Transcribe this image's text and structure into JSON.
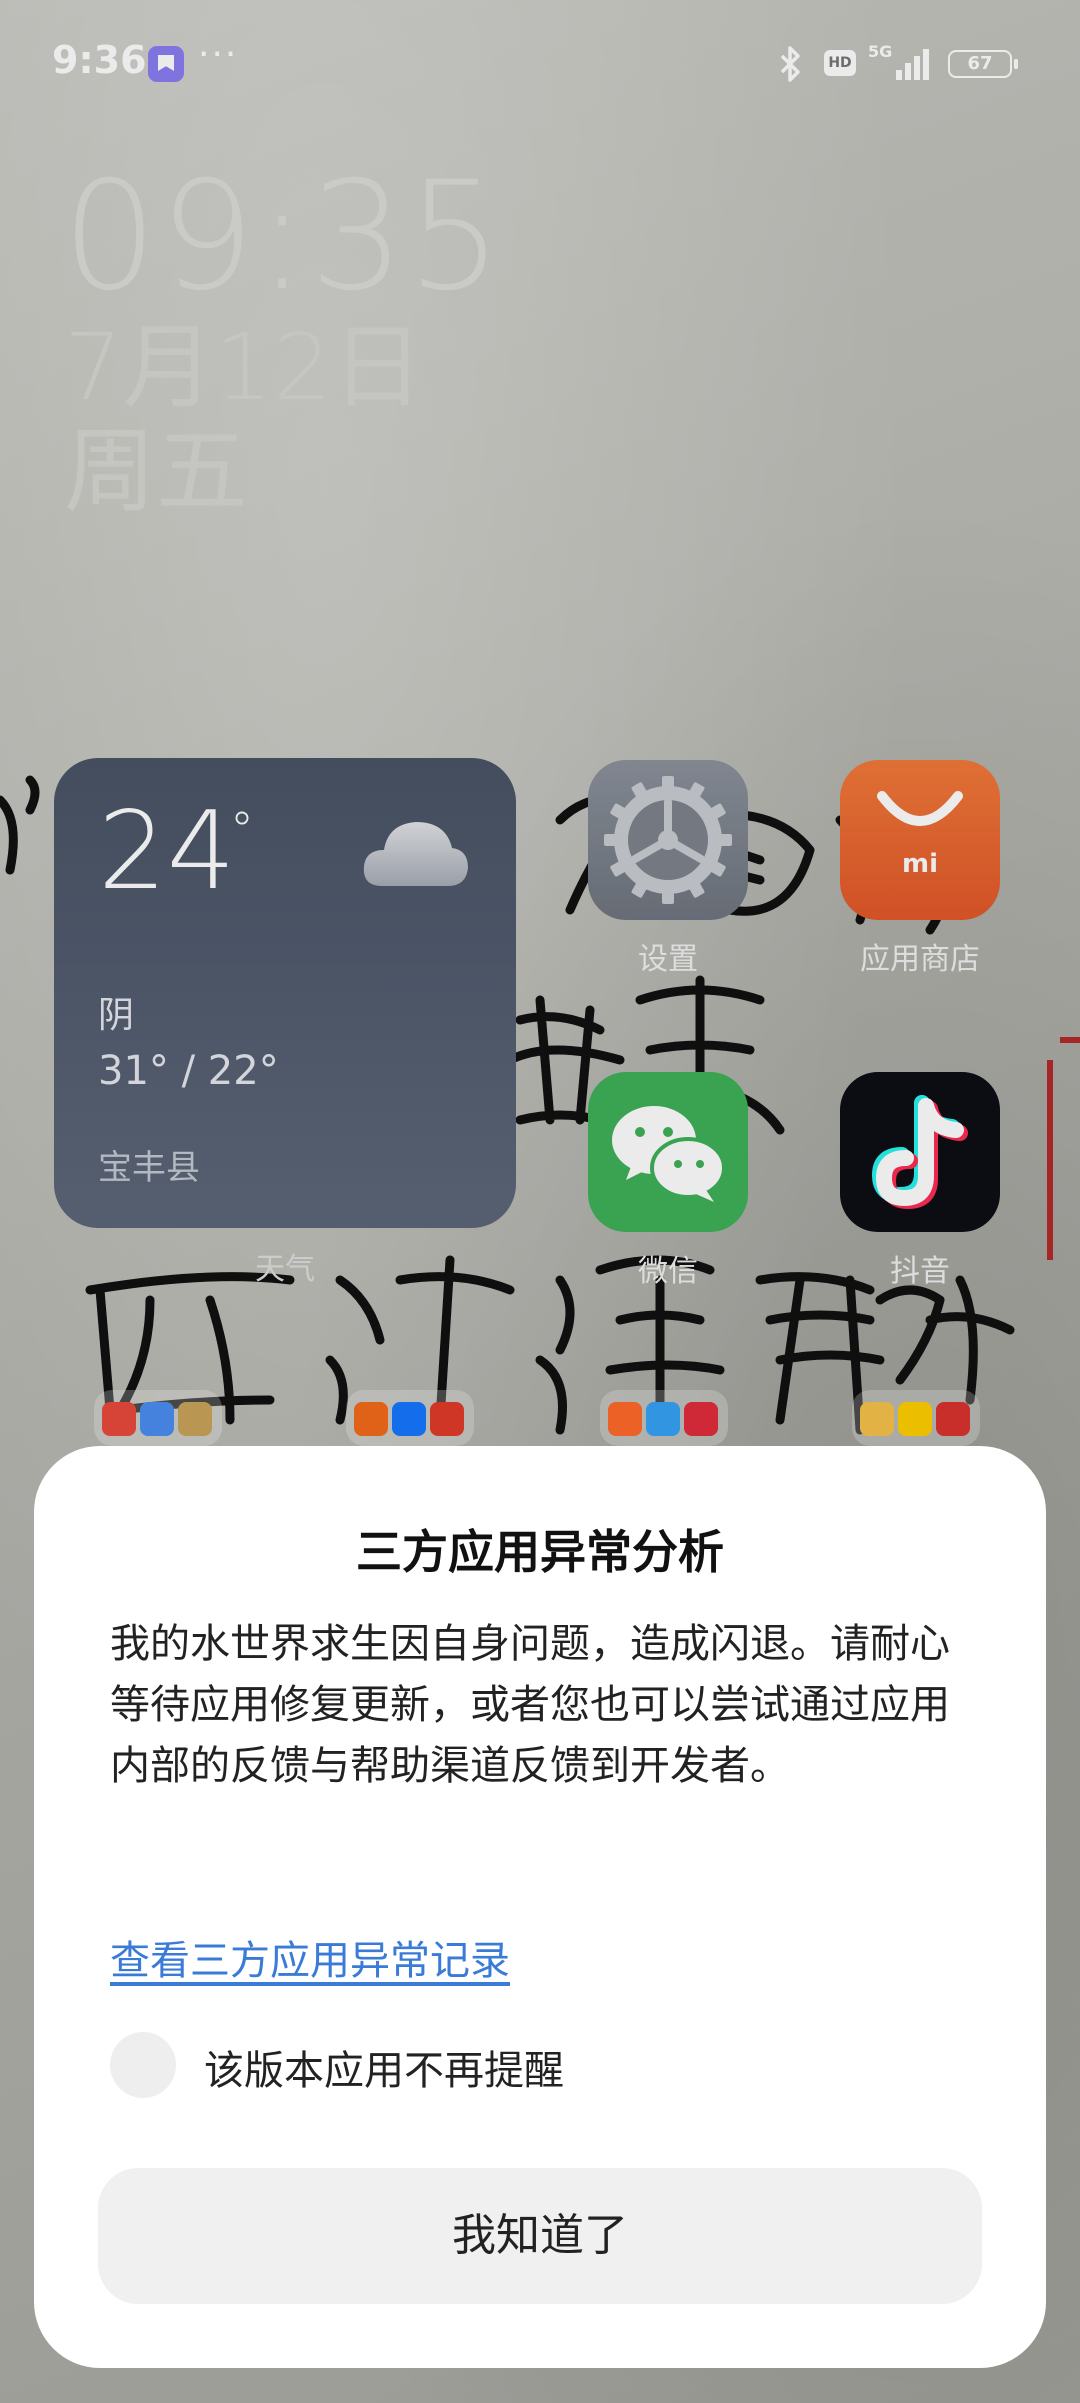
{
  "status_bar": {
    "time": "9:36",
    "more": "···",
    "network_hd": "HD",
    "network_5g": "5G",
    "battery": "67",
    "icons": [
      "app-notification-icon",
      "bluetooth-icon",
      "hd-icon",
      "signal-icon",
      "battery-icon"
    ]
  },
  "clock": {
    "time": "09:35",
    "date": "7月12日",
    "weekday": "周五"
  },
  "weather_widget": {
    "temperature": "24",
    "degree": "°",
    "condition": "阴",
    "range": "31° / 22°",
    "location": "宝丰县",
    "label": "天气",
    "icon": "cloud-icon"
  },
  "apps": [
    {
      "label": "设置",
      "icon": "gear-icon"
    },
    {
      "label": "应用商店",
      "icon": "store-bag-icon"
    },
    {
      "label": "微信",
      "icon": "wechat-icon"
    },
    {
      "label": "抖音",
      "icon": "douyin-icon"
    }
  ],
  "dialog": {
    "title": "三方应用异常分析",
    "body": "我的水世界求生因自身问题，造成闪退。请耐心等待应用修复更新，或者您也可以尝试通过应用内部的反馈与帮助渠道反馈到开发者。",
    "link": "查看三方应用异常记录",
    "checkbox_label": "该版本应用不再提醒",
    "checkbox_checked": false,
    "confirm_button": "我知道了"
  },
  "colors": {
    "link": "#3b7bd8",
    "dialog_bg": "#ffffff",
    "button_bg": "#f0f0f0"
  }
}
